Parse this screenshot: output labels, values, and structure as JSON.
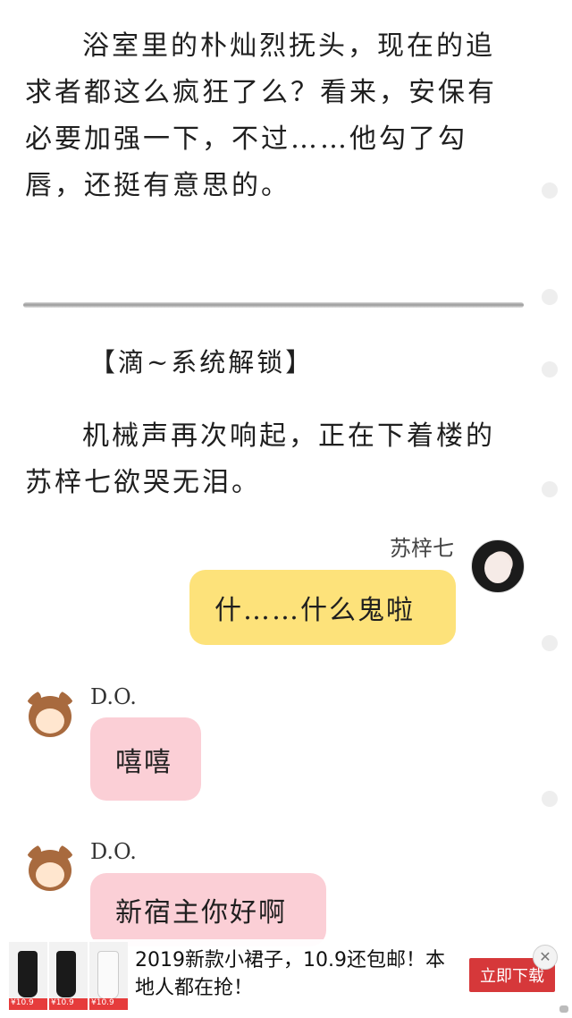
{
  "story": {
    "para1": "浴室里的朴灿烈抚头，现在的追求者都这么疯狂了么？看来，安保有必要加强一下，不过……他勾了勾唇，还挺有意思的。",
    "system": "【滴~系统解锁】",
    "para2": "机械声再次响起，正在下着楼的苏梓七欲哭无泪。"
  },
  "chat": [
    {
      "name": "苏梓七",
      "text": "什……什么鬼啦",
      "side": "right",
      "color": "#fde27a"
    },
    {
      "name": "D.O.",
      "text": "嘻嘻",
      "side": "left",
      "color": "#fbcfd6"
    },
    {
      "name": "D.O.",
      "text": "新宿主你好啊",
      "side": "left",
      "color": "#fbcfd6"
    }
  ],
  "ad": {
    "text": "2019新款小裙子，10.9还包邮！本地人都在抢！",
    "button": "立即下载",
    "price_tag": "¥10.9"
  },
  "colors": {
    "divider": "#9a9a9a",
    "scroll_dot": "#eeeeee"
  }
}
